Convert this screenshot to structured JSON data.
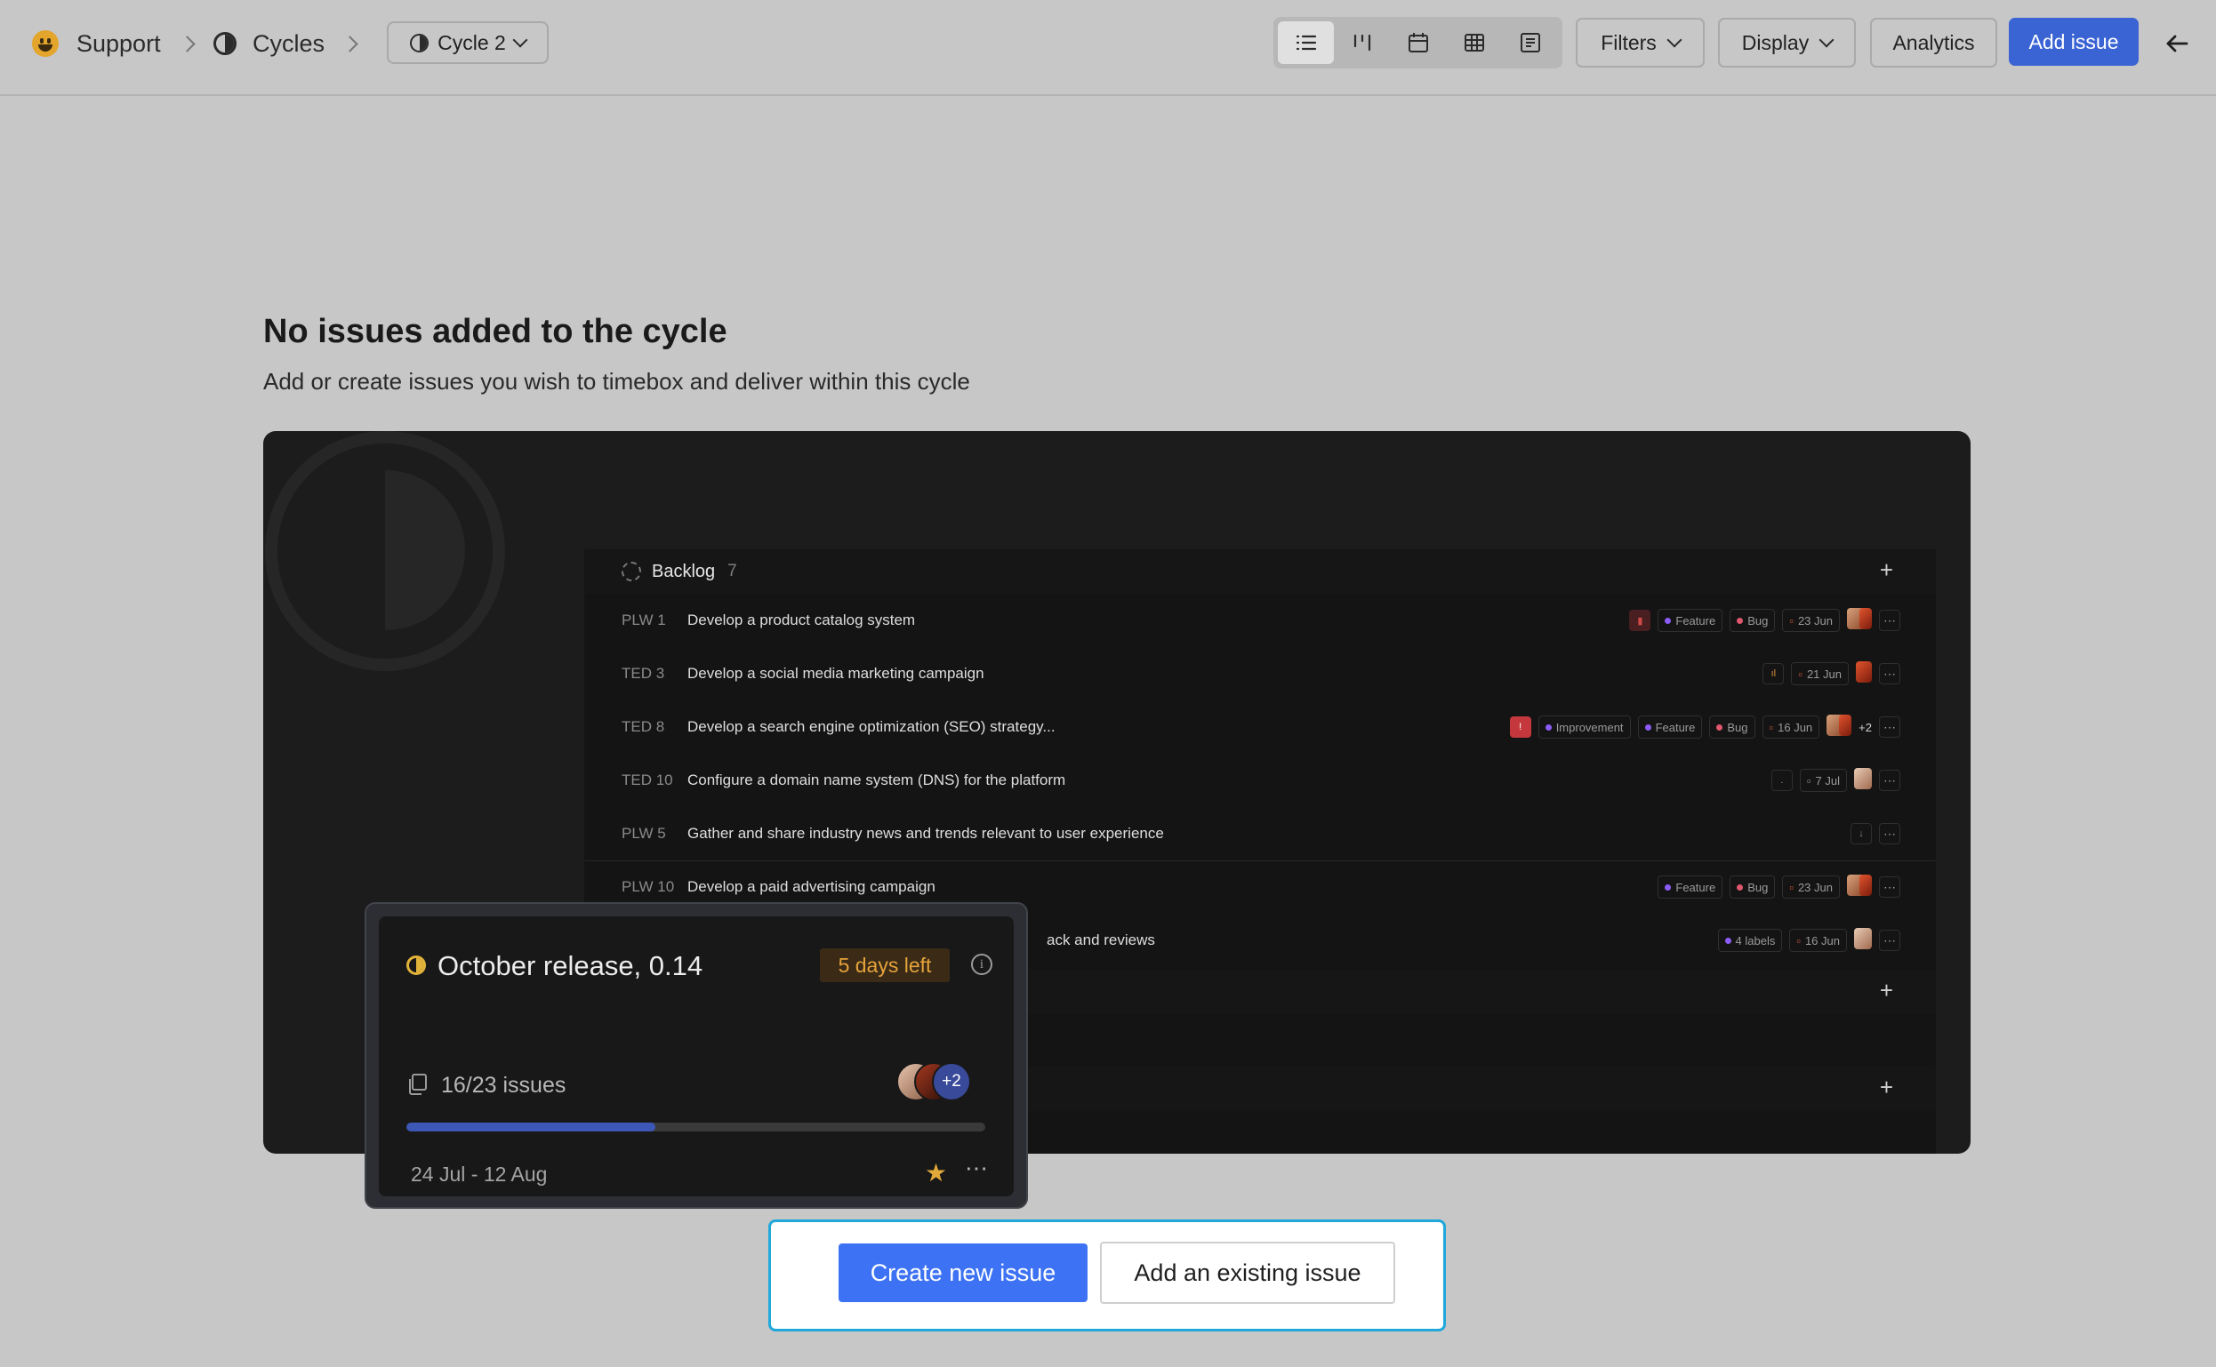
{
  "breadcrumb": {
    "project": "Support",
    "section": "Cycles",
    "current_cycle": "Cycle 2"
  },
  "toolbar": {
    "views": [
      "list-icon",
      "kanban-icon",
      "calendar-icon",
      "spreadsheet-icon",
      "gantt-icon"
    ],
    "active_view": "list",
    "filters_label": "Filters",
    "display_label": "Display",
    "analytics_label": "Analytics",
    "add_issue_label": "Add issue"
  },
  "empty_state": {
    "title": "No issues added to the cycle",
    "description": "Add or create issues you wish to timebox and deliver within this cycle",
    "primary_button": "Create new issue",
    "secondary_button": "Add an existing issue"
  },
  "preview": {
    "group_label": "Backlog",
    "group_count": "7",
    "rows": [
      {
        "id": "PLW 1",
        "name": "Develop a product catalog system",
        "labels": [
          "Feature",
          "Bug"
        ],
        "date": "23 Jun"
      },
      {
        "id": "TED 3",
        "name": "Develop a social media marketing campaign",
        "labels": [],
        "date": "21 Jun"
      },
      {
        "id": "TED 8",
        "name": "Develop a search engine optimization (SEO) strategy...",
        "labels": [
          "Improvement",
          "Feature",
          "Bug"
        ],
        "date": "16 Jun",
        "extra_assignees": "+2"
      },
      {
        "id": "TED 10",
        "name": "Configure a domain name system (DNS) for the platform",
        "labels": [],
        "date": "7 Jul"
      },
      {
        "id": "PLW 5",
        "name": "Gather and share industry news and trends relevant to user experience",
        "labels": [],
        "date": ""
      },
      {
        "id": "PLW 10",
        "name": "Develop a paid advertising campaign",
        "labels": [
          "Feature",
          "Bug"
        ],
        "date": "23 Jun"
      },
      {
        "id": "",
        "name": "ack and reviews",
        "labels": [
          "4 labels"
        ],
        "date": "16 Jun"
      }
    ],
    "card": {
      "title": "October release, 0.14",
      "days_left": "5 days left",
      "issues": "16/23 issues",
      "progress": 0.43,
      "extra_members": "+2",
      "dates": "24 Jul - 12 Aug"
    }
  },
  "colors": {
    "accent": "#3a63d4",
    "create_button": "#3c72f3",
    "focus_ring": "#1fa8d9",
    "warning": "#e5a33b"
  }
}
